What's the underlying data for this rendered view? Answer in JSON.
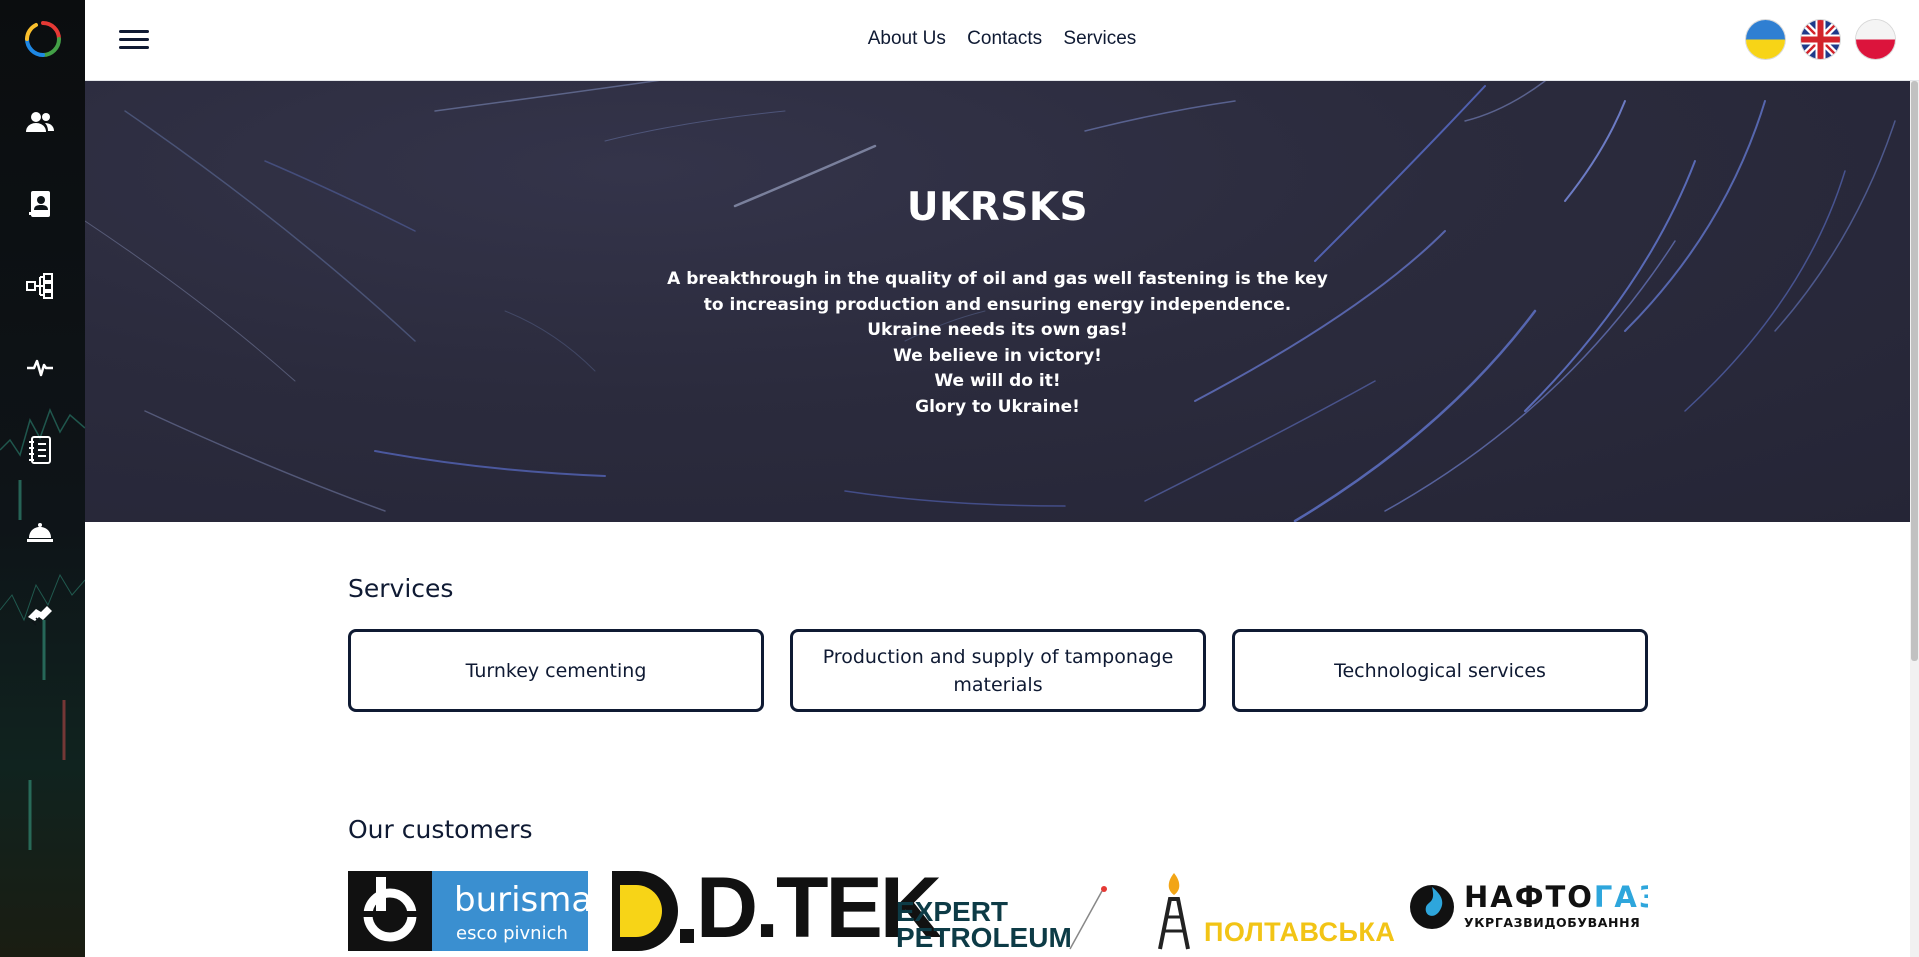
{
  "sidebar": {
    "items": [
      {
        "icon": "users-icon"
      },
      {
        "icon": "contacts-book-icon"
      },
      {
        "icon": "structure-icon"
      },
      {
        "icon": "pulse-icon"
      },
      {
        "icon": "document-list-icon"
      },
      {
        "icon": "service-bell-icon"
      },
      {
        "icon": "handshake-icon"
      }
    ]
  },
  "nav": {
    "about": "About Us",
    "contacts": "Contacts",
    "services": "Services"
  },
  "languages": [
    "ua",
    "en",
    "pl"
  ],
  "hero": {
    "title": "UKRSKS",
    "lines": [
      "A breakthrough in the quality of oil and gas well fastening is the key",
      "to increasing production and ensuring energy independence.",
      "Ukraine needs its own gas!",
      "We believe in victory!",
      "We will do it!",
      "Glory to Ukraine!"
    ]
  },
  "services": {
    "title": "Services",
    "items": [
      "Turnkey cementing",
      "Production and supply of tamponage materials",
      "Technological services"
    ]
  },
  "customers": {
    "title": "Our customers",
    "logos": {
      "burisma_main": "burisma",
      "burisma_sub": "esco pivnich",
      "dtek": "D.TEK",
      "expert_line1": "EXPERT",
      "expert_line2": "PETROLEUM",
      "poltava": "ПОЛТАВСЬКА",
      "naftogaz_part1": "НАФТО",
      "naftogaz_part2": "ГАЗ",
      "naftogaz_sub": "УКРГАЗВИДОБУВАННЯ"
    }
  },
  "colors": {
    "navy": "#0f1a33",
    "hero_bg": "#2b2b3d",
    "burisma_blue": "#3a8fd0",
    "dtek_yellow": "#f7d417",
    "poltava_yellow": "#f2c416",
    "naftogaz_blue": "#2ea6dc"
  }
}
